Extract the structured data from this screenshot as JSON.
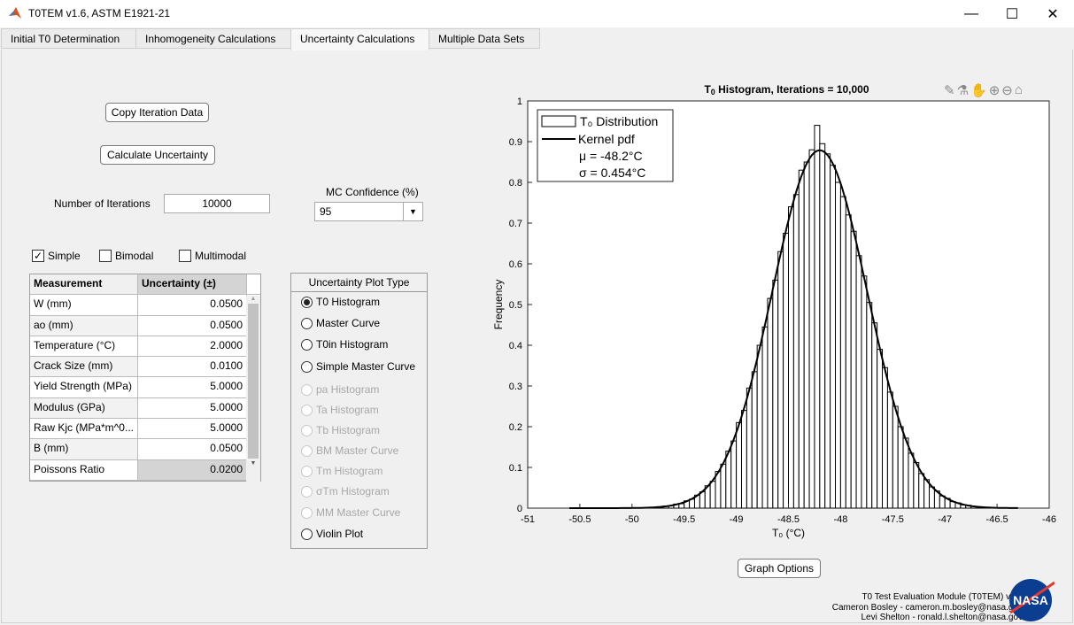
{
  "window": {
    "title": "T0TEM v1.6, ASTM E1921-21",
    "minimize": "—",
    "maximize": "☐",
    "close": "✕"
  },
  "tabs": [
    {
      "label": "Initial T0 Determination"
    },
    {
      "label": "Inhomogeneity Calculations"
    },
    {
      "label": "Uncertainty Calculations",
      "active": true
    },
    {
      "label": "Multiple Data Sets"
    }
  ],
  "buttons": {
    "copy": "Copy Iteration Data",
    "calculate": "Calculate Uncertainty",
    "graph_options": "Graph Options"
  },
  "iterations": {
    "label": "Number of Iterations",
    "value": "10000"
  },
  "confidence": {
    "label": "MC Confidence (%)",
    "value": "95"
  },
  "modes": [
    {
      "label": "Simple",
      "checked": true
    },
    {
      "label": "Bimodal",
      "checked": false
    },
    {
      "label": "Multimodal",
      "checked": false
    }
  ],
  "table": {
    "headers": [
      "Measurement",
      "Uncertainty (±)"
    ],
    "rows": [
      [
        "W (mm)",
        "0.0500"
      ],
      [
        "ao (mm)",
        "0.0500"
      ],
      [
        "Temperature (°C)",
        "2.0000"
      ],
      [
        "Crack Size (mm)",
        "0.0100"
      ],
      [
        "Yield Strength (MPa)",
        "5.0000"
      ],
      [
        "Modulus (GPa)",
        "5.0000"
      ],
      [
        "Raw Kjc (MPa*m^0...",
        "5.0000"
      ],
      [
        "B (mm)",
        "0.0500"
      ],
      [
        "Poissons Ratio",
        "0.0200"
      ]
    ]
  },
  "plot_type": {
    "title": "Uncertainty Plot Type",
    "options": [
      {
        "label": "T0 Histogram",
        "selected": true,
        "enabled": true
      },
      {
        "label": "Master Curve",
        "enabled": true
      },
      {
        "label": "T0in Histogram",
        "enabled": true
      },
      {
        "label": "Simple Master Curve",
        "enabled": true
      },
      {
        "label": "pa Histogram",
        "enabled": false
      },
      {
        "label": "Ta Histogram",
        "enabled": false
      },
      {
        "label": "Tb Histogram",
        "enabled": false
      },
      {
        "label": "BM Master Curve",
        "enabled": false
      },
      {
        "label": "Tm Histogram",
        "enabled": false
      },
      {
        "label": "σTm Histogram",
        "enabled": false
      },
      {
        "label": "MM Master Curve",
        "enabled": false
      },
      {
        "label": "Violin Plot",
        "enabled": true
      }
    ]
  },
  "toolbar_icons": [
    "brush-icon",
    "data-tip-icon",
    "pan-hand-icon",
    "zoom-in-icon",
    "zoom-out-icon",
    "home-icon"
  ],
  "chart_data": {
    "type": "bar",
    "title_main": "T",
    "title_sub": "0",
    "title_rest": "  Histogram,  Iterations  =  10,000",
    "xlabel": "T₀  (°C)",
    "ylabel": "Frequency",
    "xlim": [
      -51,
      -46
    ],
    "ylim": [
      0,
      1
    ],
    "xticks": [
      "-51",
      "-50.5",
      "-50",
      "-49.5",
      "-49",
      "-48.5",
      "-48",
      "-47.5",
      "-47",
      "-46.5",
      "-46"
    ],
    "yticks": [
      "0",
      "0.1",
      "0.2",
      "0.3",
      "0.4",
      "0.5",
      "0.6",
      "0.7",
      "0.8",
      "0.9",
      "1"
    ],
    "bin_start": -50.0,
    "bin_width": 0.05,
    "values": [
      0.0004,
      0.0006,
      0.001,
      0.0015,
      0.002,
      0.003,
      0.005,
      0.006,
      0.01,
      0.011,
      0.018,
      0.022,
      0.032,
      0.04,
      0.055,
      0.066,
      0.09,
      0.108,
      0.14,
      0.165,
      0.21,
      0.24,
      0.295,
      0.335,
      0.4,
      0.445,
      0.515,
      0.56,
      0.63,
      0.675,
      0.74,
      0.77,
      0.83,
      0.85,
      0.88,
      0.94,
      0.895,
      0.87,
      0.842,
      0.8,
      0.765,
      0.72,
      0.68,
      0.62,
      0.57,
      0.505,
      0.455,
      0.39,
      0.345,
      0.285,
      0.25,
      0.2,
      0.172,
      0.135,
      0.112,
      0.085,
      0.07,
      0.052,
      0.042,
      0.03,
      0.024,
      0.016,
      0.013,
      0.008,
      0.007,
      0.004,
      0.003,
      0.002,
      0.0015,
      0.001,
      0.0006,
      0.0004
    ],
    "kernel": {
      "mu": -48.2,
      "sigma": 0.454
    },
    "legend": {
      "position": "top-left",
      "distribution": "T₀  Distribution",
      "kernel": "Kernel pdf",
      "mu": "μ  =  -48.2°C",
      "sigma": "σ  =  0.454°C"
    }
  },
  "footer": {
    "line1": "T0 Test Evaluation Module (T0TEM) v1.6",
    "line2": "Cameron Bosley - cameron.m.bosley@nasa.gov",
    "line3": "Levi Shelton - ronald.l.shelton@nasa.gov",
    "logo": "NASA"
  }
}
